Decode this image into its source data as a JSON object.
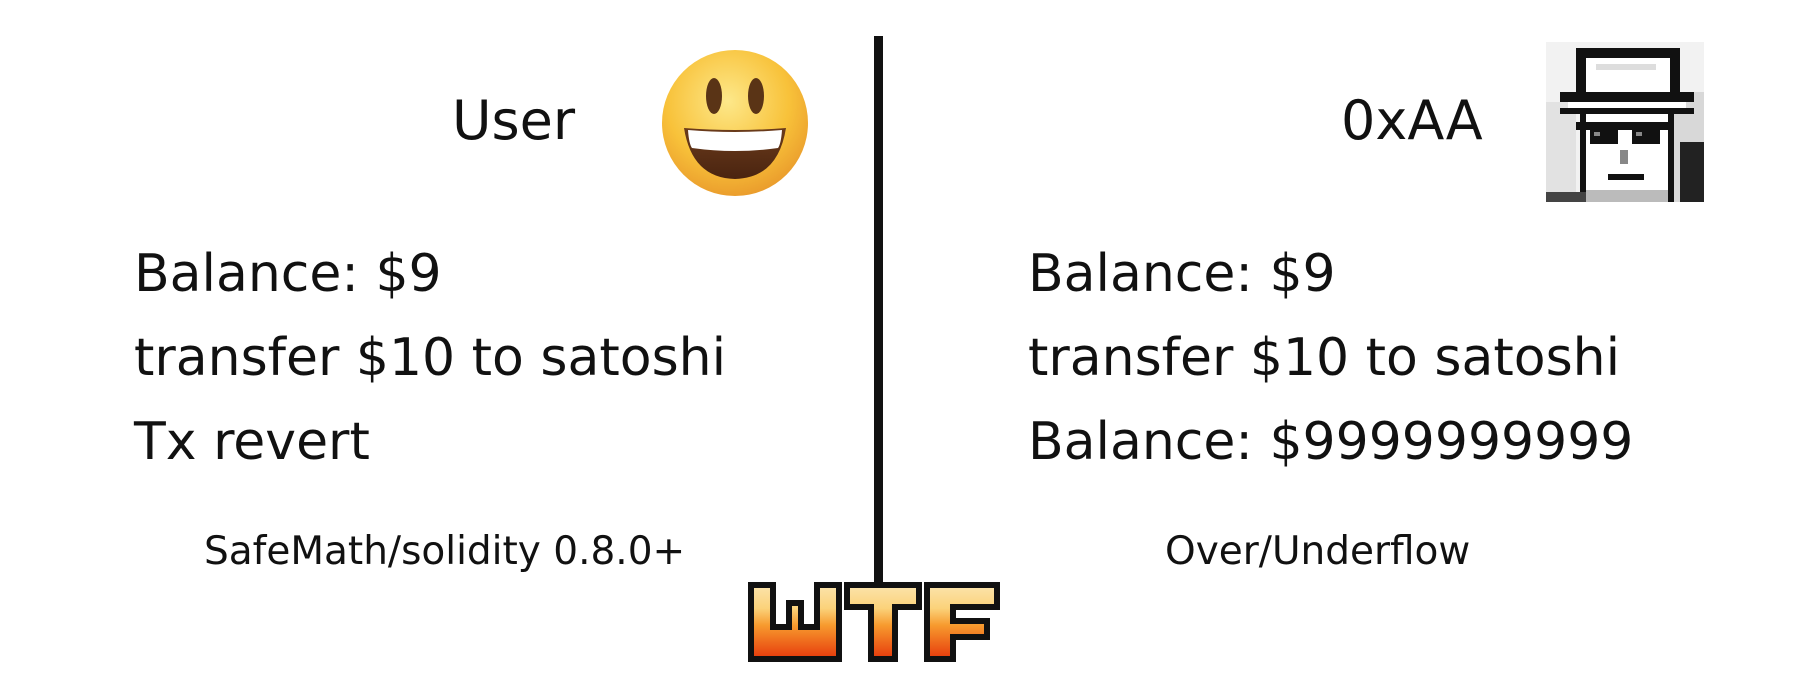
{
  "left_panel": {
    "title": "User",
    "lines": [
      "Balance: $9",
      "transfer $10 to satoshi",
      "Tx revert"
    ],
    "note": "SafeMath/solidity 0.8.0+",
    "avatar_icon": "smiling-face-icon"
  },
  "right_panel": {
    "title": "0xAA",
    "lines": [
      "Balance: $9",
      "transfer $10 to satoshi",
      "Balance: $9999999999"
    ],
    "note": "Over/Underflow",
    "avatar_icon": "pixel-avatar-icon"
  },
  "logo": {
    "text": "WTF",
    "colors": {
      "top": "#fbe2a6",
      "middle": "#f79a2e",
      "bottom": "#e8410e",
      "outline": "#111111"
    }
  },
  "colors": {
    "text": "#111111",
    "divider": "#111111",
    "smiley_face": "#f8c23a"
  }
}
